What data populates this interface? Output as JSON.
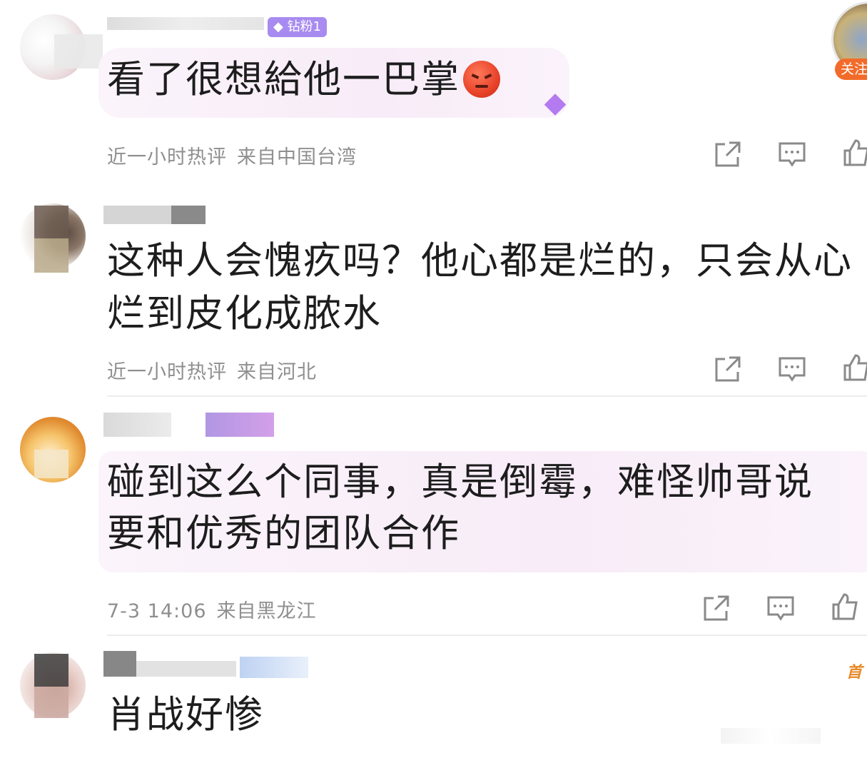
{
  "header_user": {
    "fan_badge": "钻粉1",
    "follow_label": "关注"
  },
  "comments": [
    {
      "text_lines": [
        "看了很想給他一巴掌"
      ],
      "meta_time": "近一小时热评",
      "meta_location": "来自中国台湾"
    },
    {
      "text_lines": [
        "这种人会愧疚吗？他心都是烂的，只会从心",
        "烂到皮化成脓水"
      ],
      "meta_time": "近一小时热评",
      "meta_location": "来自河北"
    },
    {
      "text_lines": [
        "碰到这么个同事，真是倒霉，难怪帅哥说",
        "要和优秀的团队合作"
      ],
      "meta_time": "7-3 14:06",
      "meta_location": "来自黑龙江"
    },
    {
      "text_lines": [
        "肖战好惨"
      ],
      "meta_time": "",
      "meta_location": ""
    }
  ],
  "colors": {
    "meta_gray": "#8f8f8f",
    "badge_purple": "#a78bf0",
    "follow_orange": "#f26b2a"
  }
}
